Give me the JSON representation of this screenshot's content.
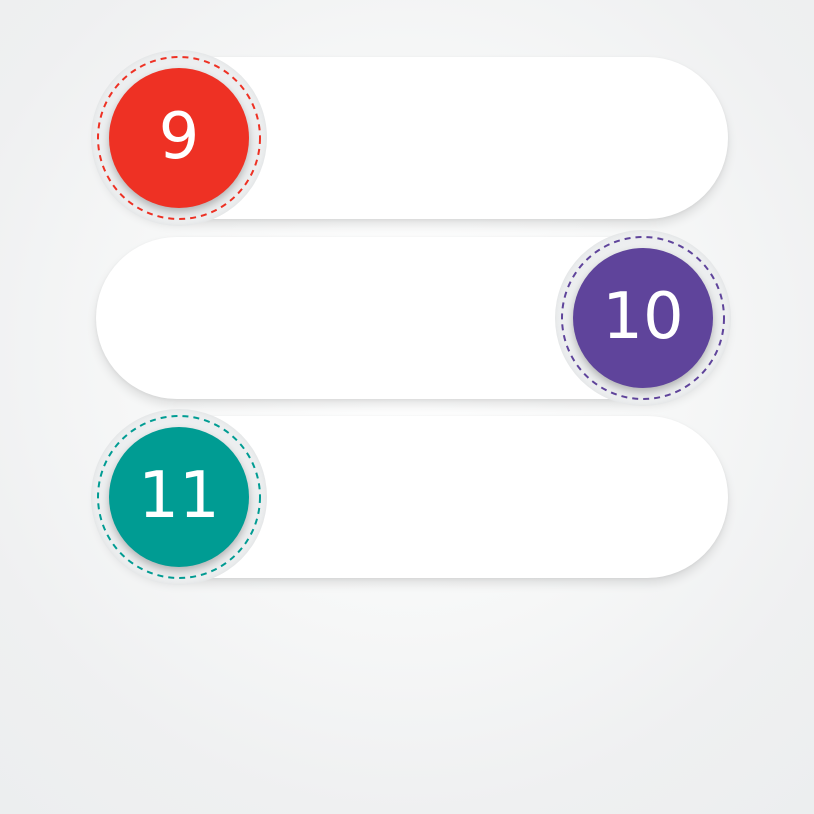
{
  "items": [
    {
      "number": "9",
      "color": "#ee3124",
      "side": "left"
    },
    {
      "number": "10",
      "color": "#5f449b",
      "side": "right"
    },
    {
      "number": "11",
      "color": "#009c93",
      "side": "left"
    }
  ]
}
